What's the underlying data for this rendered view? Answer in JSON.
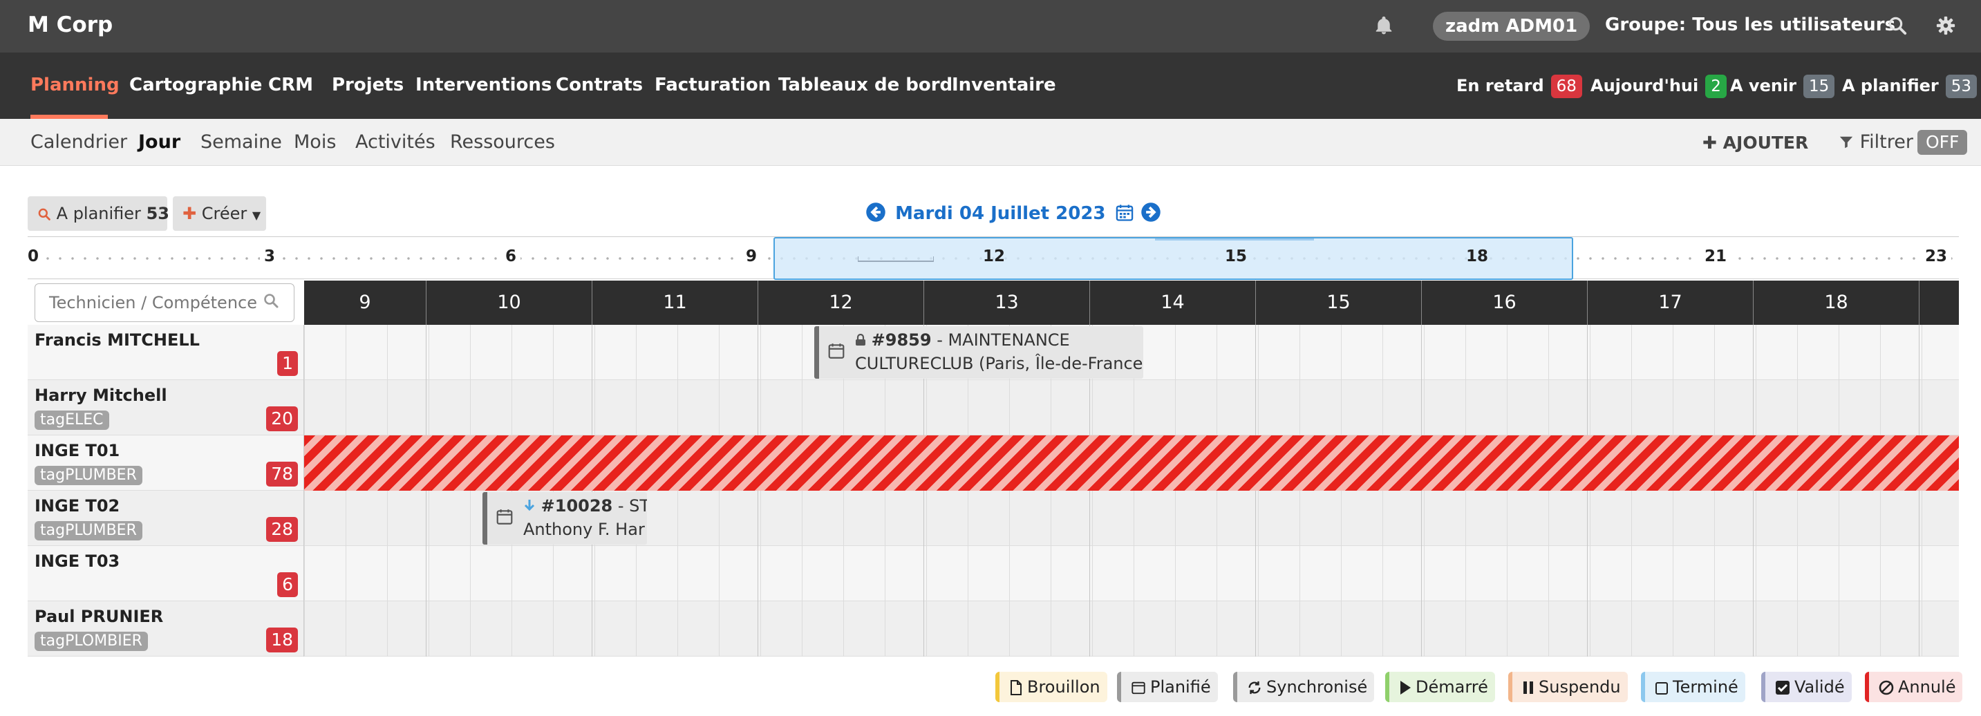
{
  "topbar": {
    "brand": "M Corp",
    "user": "zadm ADM01",
    "group": "Groupe: Tous les utilisateurs",
    "icons": [
      "bell-icon",
      "search-icon",
      "gear-icon"
    ]
  },
  "nav": {
    "items": [
      "Planning",
      "Cartographie",
      "CRM",
      "Projets",
      "Interventions",
      "Contrats",
      "Facturation",
      "Tableaux de bord",
      "Inventaire"
    ],
    "active": "Planning",
    "counters": [
      {
        "label": "En retard",
        "count": "68",
        "color": "#d9363e"
      },
      {
        "label": "Aujourd'hui",
        "count": "2",
        "color": "#27a745"
      },
      {
        "label": "A venir",
        "count": "15",
        "color": "#6c757d"
      },
      {
        "label": "A planifier",
        "count": "53",
        "color": "#6c757d"
      }
    ]
  },
  "subnav": {
    "items": [
      "Calendrier",
      "Jour",
      "Semaine",
      "Mois",
      "Activités",
      "Ressources"
    ],
    "active": "Jour",
    "add_label": "AJOUTER",
    "filter_label": "Filtrer",
    "filter_state": "OFF"
  },
  "toolbar": {
    "plan_label": "A planifier",
    "plan_count": "53",
    "create_label": "Créer",
    "date": "Mardi 04 Juillet 2023"
  },
  "timeline": {
    "labels": [
      "0",
      "3",
      "6",
      "9",
      "12",
      "15",
      "18",
      "21",
      "23"
    ]
  },
  "grid": {
    "search_placeholder": "Technicien / Compétence",
    "hours": [
      "9",
      "10",
      "11",
      "12",
      "13",
      "14",
      "15",
      "16",
      "17",
      "18"
    ],
    "technicians": [
      {
        "name": "Francis MITCHELL",
        "tag": "",
        "count": "1"
      },
      {
        "name": "Harry Mitchell",
        "tag": "tagELEC",
        "count": "20"
      },
      {
        "name": "INGE T01",
        "tag": "tagPLUMBER",
        "count": "78"
      },
      {
        "name": "INGE T02",
        "tag": "tagPLUMBER",
        "count": "28"
      },
      {
        "name": "INGE T03",
        "tag": "",
        "count": "6"
      },
      {
        "name": "Paul PRUNIER",
        "tag": "tagPLOMBIER",
        "count": "18"
      }
    ],
    "events": [
      {
        "id": "#9859",
        "title": "- MAINTENANCE",
        "subtitle": "CULTURECLUB (Paris, Île-de-France",
        "icon": "lock-icon"
      },
      {
        "id": "#10028",
        "title": "- ST",
        "subtitle": "Anthony F. Har",
        "icon": "arrow-down-icon"
      }
    ]
  },
  "legend": [
    {
      "label": "Brouillon",
      "bg": "#fdf3dc",
      "border": "#f3c73b"
    },
    {
      "label": "Planifié",
      "bg": "#ececec",
      "border": "#9a9a9a"
    },
    {
      "label": "Synchronisé",
      "bg": "#ececec",
      "border": "#9a9a9a"
    },
    {
      "label": "Démarré",
      "bg": "#e6f4dd",
      "border": "#8fd06b"
    },
    {
      "label": "Suspendu",
      "bg": "#fbe9dd",
      "border": "#f2b58a"
    },
    {
      "label": "Terminé",
      "bg": "#e1f0fa",
      "border": "#8cc8ee"
    },
    {
      "label": "Validé",
      "bg": "#e6e6f3",
      "border": "#9fa4c7"
    },
    {
      "label": "Annulé",
      "bg": "#fbe2e2",
      "border": "#e02424"
    }
  ]
}
